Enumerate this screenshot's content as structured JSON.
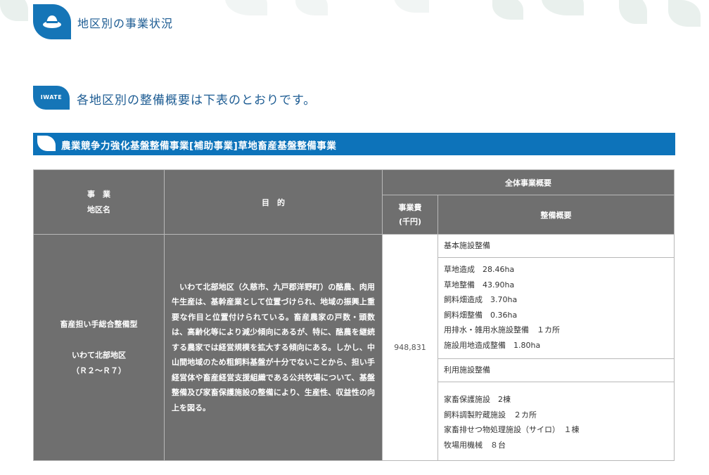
{
  "header": {
    "title": "地区別の事業状況",
    "icon": "hat-icon"
  },
  "summary": {
    "badge": "IWATE",
    "text": "各地区別の整備概要は下表のとおりです。"
  },
  "section": {
    "title": "農業競争力強化基盤整備事業[補助事業]草地畜産基盤整備事業"
  },
  "table": {
    "headers": {
      "jigyo_line1": "事　業",
      "jigyo_line2": "地区名",
      "mokuteki": "目　的",
      "zentai": "全体事業概要",
      "cost_line1": "事業費",
      "cost_line2": "(千円)",
      "seibi": "整備概要"
    },
    "row": {
      "district_line1": "畜産担い手総合整備型",
      "district_line2": "いわて北部地区",
      "district_line3": "（Ｒ２～Ｒ７）",
      "purpose": "　いわて北部地区（久慈市、九戸郡洋野町）の酪農、肉用牛生産は、基幹産業として位置づけられ、地域の振興上重要な作目と位置付けられている。畜産農家の戸数・頭数は、高齢化等により減少傾向にあるが、特に、酪農を継続する農家では経営規模を拡大する傾向にある。しかし、中山間地域のため粗飼料基盤が十分でないことから、担い手経営体や畜産経営支援組織である公共牧場について、基盤整備及び家畜保護施設の整備により、生産性、収益性の向上を図る。",
      "cost": "948,831",
      "basic_title": "基本施設整備",
      "basic_items": [
        "草地造成　28.46ha",
        "草地整備　43.90ha",
        "飼料畑造成　3.70ha",
        "飼料畑整備　0.36ha",
        "用排水・雑用水施設整備　１カ所",
        "施設用地造成整備　1.80ha"
      ],
      "use_title": "利用施設整備",
      "use_items": [
        "家畜保護施設　2棟",
        "飼料調製貯蔵施設　２カ所",
        "家畜排せつ物処理施設（サイロ）　１棟",
        "牧場用機械　８台"
      ]
    }
  }
}
